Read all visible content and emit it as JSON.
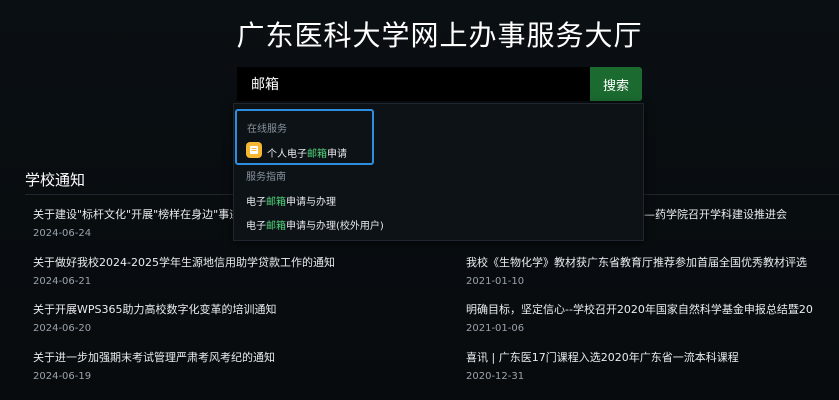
{
  "header": {
    "title": "广东医科大学网上办事服务大厅"
  },
  "search": {
    "value": "邮箱",
    "button_label": "搜索"
  },
  "dropdown": {
    "group1": {
      "heading": "在线服务",
      "item": {
        "prefix": "个人电子",
        "highlight": "邮箱",
        "suffix": "申请"
      }
    },
    "group2": {
      "heading": "服务指南",
      "items": [
        {
          "prefix": "电子",
          "highlight": "邮箱",
          "suffix": "申请与办理"
        },
        {
          "prefix": "电子",
          "highlight": "邮箱",
          "suffix": "申请与办理(校外用户)"
        }
      ]
    }
  },
  "notices": {
    "section_title": "学校通知",
    "left": [
      {
        "title": "关于建设\"标杆文化\"开展\"榜样在身边\"事迹",
        "date": "2024-06-24"
      },
      {
        "title": "关于做好我校2024-2025学年生源地信用助学贷款工作的通知",
        "date": "2024-06-21"
      },
      {
        "title": "关于开展WPS365助力高校数字化变革的培训通知",
        "date": "2024-06-20"
      },
      {
        "title": "关于进一步加强期末考试管理严肃考风考纪的通知",
        "date": "2024-06-19"
      }
    ],
    "right": [
      {
        "title": "—药学院召开学科建设推进会",
        "date": ""
      },
      {
        "title": "我校《生物化学》教材获广东省教育厅推荐参加首届全国优秀教材评选",
        "date": "2021-01-10"
      },
      {
        "title": "明确目标，坚定信心--学校召开2020年国家自然科学基金申报总结暨20",
        "date": "2021-01-06"
      },
      {
        "title": "喜讯 | 广东医17门课程入选2020年广东省一流本科课程",
        "date": "2020-12-31"
      }
    ]
  },
  "colors": {
    "accent_green": "#1b6b30",
    "highlight": "#52d67a",
    "focus_blue": "#2f8ee0"
  },
  "icons": {
    "service_badge": "document-badge-icon"
  }
}
